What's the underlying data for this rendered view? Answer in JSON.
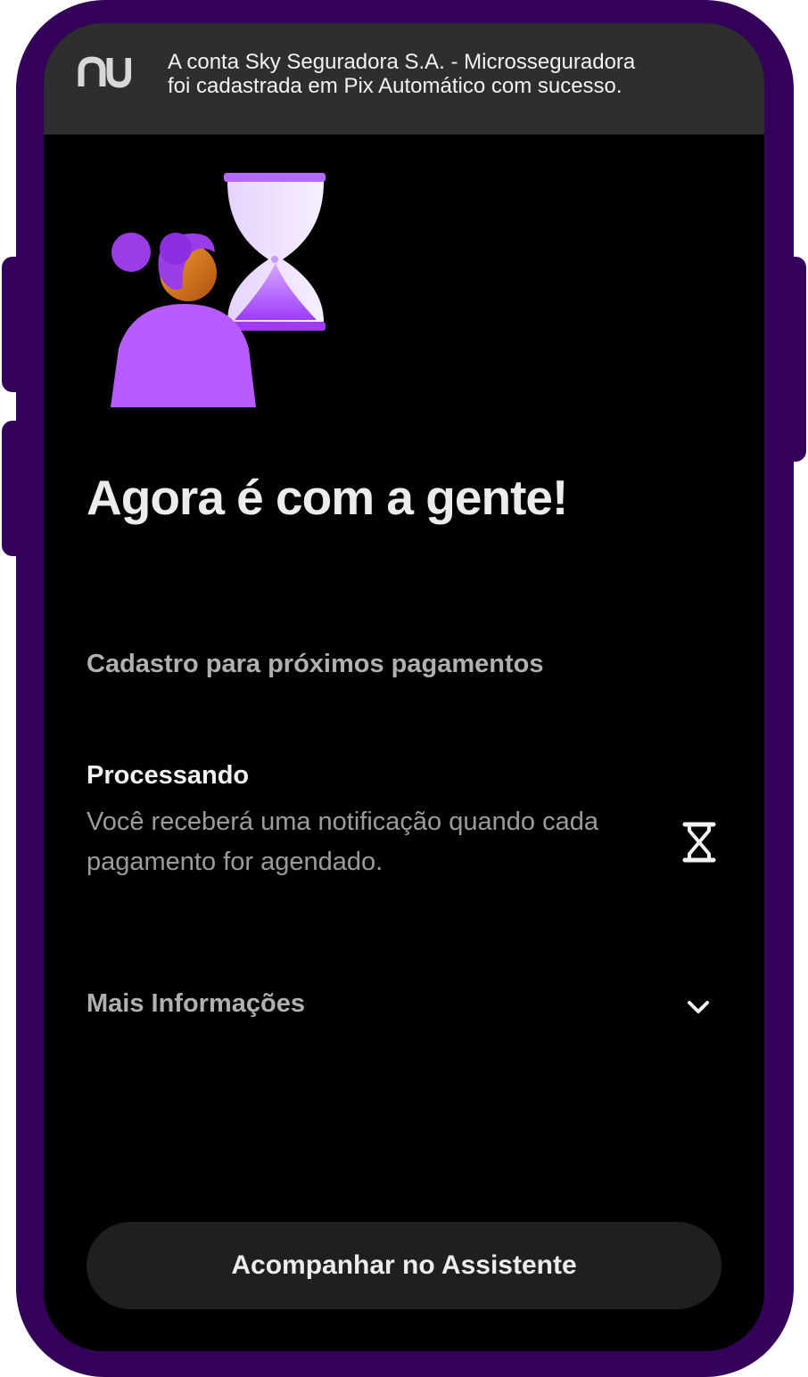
{
  "notification": {
    "app_icon": "nubank-logo-icon",
    "message_line1": "A conta Sky Seguradora S.A. - Microsseguradora",
    "message_line2": "foi cadastrada em Pix Automático com sucesso."
  },
  "illustration": {
    "icon": "person-waiting-hourglass-illustration"
  },
  "title": "Agora é com a gente!",
  "section_label": "Cadastro para próximos pagamentos",
  "status": {
    "title": "Processando",
    "description": "Você receberá uma notificação quando cada pagamento for agendado.",
    "icon": "hourglass-icon"
  },
  "more_info": {
    "label": "Mais Informações",
    "icon": "chevron-down-icon"
  },
  "primary_button": {
    "label": "Acompanhar no Assistente"
  },
  "colors": {
    "frame": "#33005a",
    "background": "#000000",
    "notification_bg": "#2e2e2e",
    "accent_purple": "#a64dff",
    "button_bg": "#1f1f1f"
  }
}
